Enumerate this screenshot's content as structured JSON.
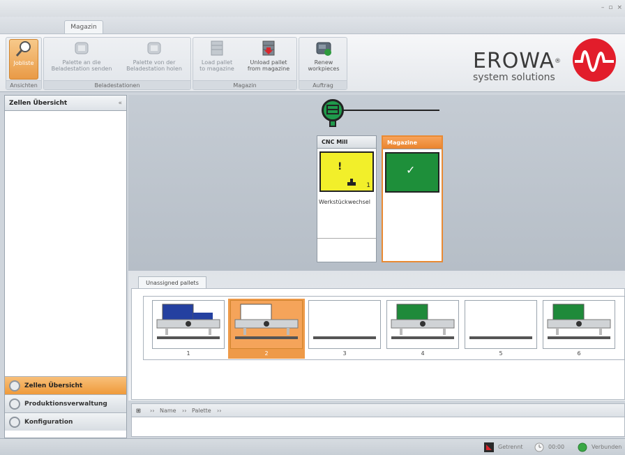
{
  "window": {
    "controls": [
      "–",
      "▫",
      "×"
    ]
  },
  "ribbon": {
    "tab": "Magazin",
    "groups": [
      {
        "label": "Ansichten",
        "buttons": [
          {
            "label1": "Jobliste",
            "label2": "",
            "icon": "magnifier-icon"
          }
        ]
      },
      {
        "label": "Beladestationen",
        "buttons": [
          {
            "label1": "Palette an die",
            "label2": "Beladestation senden",
            "icon": "pallet-send-icon"
          },
          {
            "label1": "Palette von der",
            "label2": "Beladestation holen",
            "icon": "pallet-fetch-icon"
          }
        ]
      },
      {
        "label": "Magazin",
        "buttons": [
          {
            "label1": "Load pallet",
            "label2": "to magazine",
            "icon": "load-pallet-icon"
          },
          {
            "label1": "Unload pallet",
            "label2": "from magazine",
            "icon": "unload-pallet-icon"
          }
        ]
      },
      {
        "label": "Auftrag",
        "buttons": [
          {
            "label1": "Renew",
            "label2": "workpieces",
            "icon": "renew-icon"
          }
        ]
      }
    ]
  },
  "logo": {
    "name": "EROWA",
    "reg": "®",
    "sub": "system solutions"
  },
  "left_panel": {
    "title": "Zellen Übersicht",
    "collapse": "«",
    "nav": [
      {
        "label": "Zellen Übersicht",
        "active": true
      },
      {
        "label": "Produktionsverwaltung",
        "active": false
      },
      {
        "label": "Konfiguration",
        "active": false
      }
    ]
  },
  "cells": [
    {
      "title": "CNC Mill",
      "status_color": "#f2ef2a",
      "mark": "!",
      "count": "1",
      "subtitle": "Werkstückwechsel"
    },
    {
      "title": "Magazine",
      "status_color": "#1e8f3a",
      "mark": "✓",
      "subtitle": ""
    }
  ],
  "pallets": {
    "tab": "Unassigned pallets",
    "items": [
      {
        "num": "1",
        "workpiece_color": "#2440a0",
        "selected": false,
        "has_fixture": true
      },
      {
        "num": "2",
        "workpiece_color": "#ffffff",
        "selected": true,
        "has_fixture": true
      },
      {
        "num": "3",
        "workpiece_color": "",
        "selected": false,
        "has_fixture": false
      },
      {
        "num": "4",
        "workpiece_color": "#1f8a3a",
        "selected": false,
        "has_fixture": true
      },
      {
        "num": "5",
        "workpiece_color": "",
        "selected": false,
        "has_fixture": false
      },
      {
        "num": "6",
        "workpiece_color": "#1f8a3a",
        "selected": false,
        "has_fixture": true
      }
    ]
  },
  "grid": {
    "columns": [
      "Name",
      "Palette"
    ]
  },
  "status": {
    "connection": "Getrennt",
    "time": "00:00",
    "state": "Verbunden"
  }
}
